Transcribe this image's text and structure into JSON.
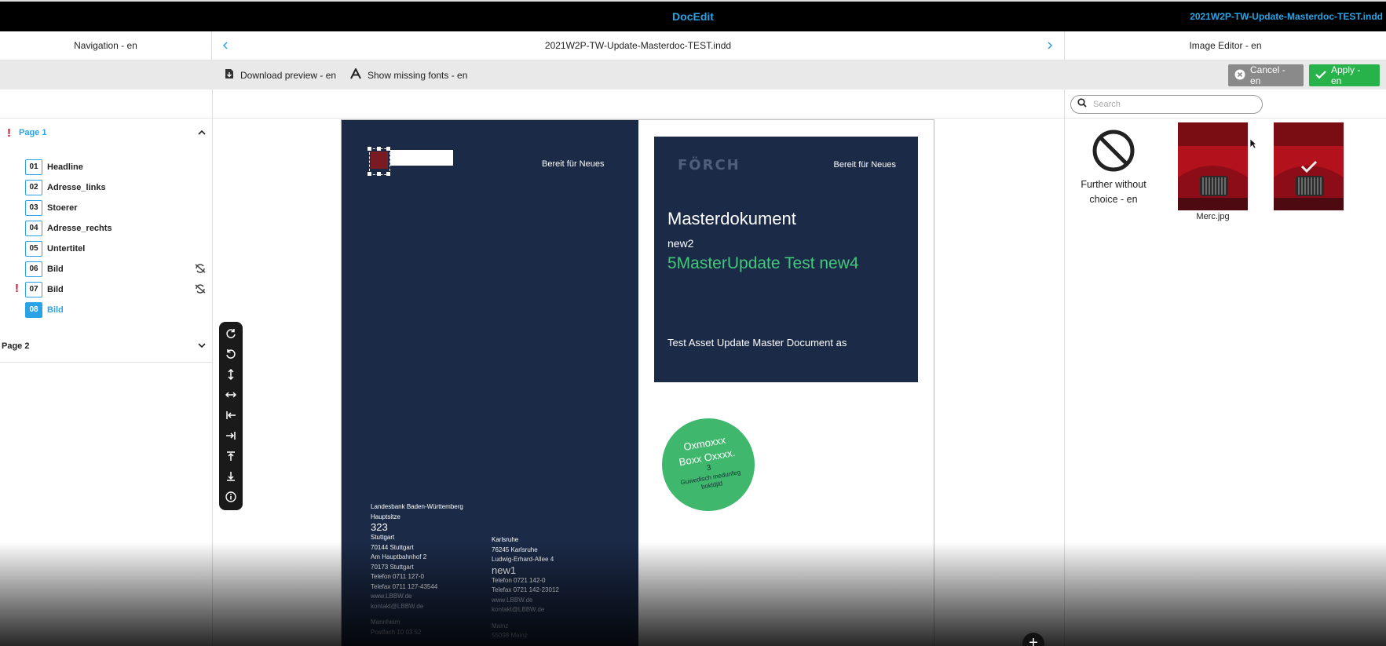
{
  "app": {
    "title": "DocEdit",
    "document_title": "2021W2P-TW-Update-Masterdoc-TEST.indd"
  },
  "header": {
    "navigation_label": "Navigation - en",
    "document_name": "2021W2P-TW-Update-Masterdoc-TEST.indd",
    "prev_icon": "chevron-left-icon",
    "next_icon": "chevron-right-icon",
    "image_editor_label": "Image Editor - en"
  },
  "toolbar": {
    "download_preview": "Download preview - en",
    "show_missing_fonts": "Show missing fonts - en",
    "cancel": "Cancel - en",
    "apply": "Apply - en"
  },
  "search": {
    "placeholder": "Search"
  },
  "navigation": {
    "pages": [
      {
        "label": "Page 1",
        "expanded": true,
        "warning": true,
        "items": [
          {
            "num": "01",
            "label": "Headline"
          },
          {
            "num": "02",
            "label": "Adresse_links"
          },
          {
            "num": "03",
            "label": "Stoerer"
          },
          {
            "num": "04",
            "label": "Adresse_rechts"
          },
          {
            "num": "05",
            "label": "Untertitel"
          },
          {
            "num": "06",
            "label": "Bild",
            "sync_icon": true
          },
          {
            "num": "07",
            "label": "Bild",
            "sync_icon": true,
            "warning": true
          },
          {
            "num": "08",
            "label": "Bild",
            "active": true
          }
        ]
      },
      {
        "label": "Page 2",
        "expanded": false
      }
    ]
  },
  "canvas": {
    "left_tagline": "Bereit für Neues",
    "address_left": {
      "bank": "Landesbank Baden-Württemberg",
      "hq": "Hauptsitze",
      "num": "323",
      "lines": [
        "Stuttgart",
        "70144 Stuttgart",
        "Am Hauptbahnhof 2",
        "70173 Stuttgart",
        "Telefon 0711 127-0",
        "Telefax 0711 127-43544",
        "www.LBBW.de",
        "kontakt@LBBW.de"
      ],
      "extra": [
        "Mannheim",
        "Postfach 10 03 52"
      ]
    },
    "address_right": {
      "lines1": [
        "Karlsruhe",
        "76245 Karlsruhe",
        "Ludwig-Erhard-Allee 4"
      ],
      "new": "new1",
      "lines2": [
        "Telefon 0721 142-0",
        "Telefax 0721 142-23012",
        "www.LBBW.de",
        "kontakt@LBBW.de"
      ],
      "extra": [
        "Mainz",
        "55098 Mainz"
      ]
    },
    "logo_text": "FÖRCH",
    "right_tagline": "Bereit für Neues",
    "title": "Masterdokument",
    "subtitle": "new2",
    "green_text": "5MasterUpdate Test new4",
    "description": "Test Asset Update Master Document as",
    "badge": {
      "line1": "Oxmoxxx",
      "line2": "Boxx Oxxxx.",
      "line3": "3",
      "line4": "Guwedisch medunfeg",
      "line5": "bokldjld"
    },
    "tools": [
      "rotate-cw-icon",
      "rotate-ccw-icon",
      "fit-vertical-icon",
      "fit-horizontal-icon",
      "align-left-icon",
      "align-right-icon",
      "align-top-icon",
      "align-bottom-icon",
      "info-icon"
    ]
  },
  "image_editor": {
    "no_choice_label": "Further without choice - en",
    "images": [
      {
        "label": "Merc.jpg"
      },
      {
        "label": "",
        "selected": true
      }
    ]
  },
  "colors": {
    "accent": "#2aa3e6",
    "apply": "#27b24a",
    "cancel": "#8a8a8a",
    "doc_navy": "#1b2a47",
    "green": "#41c87a",
    "warning": "#d0132a"
  }
}
